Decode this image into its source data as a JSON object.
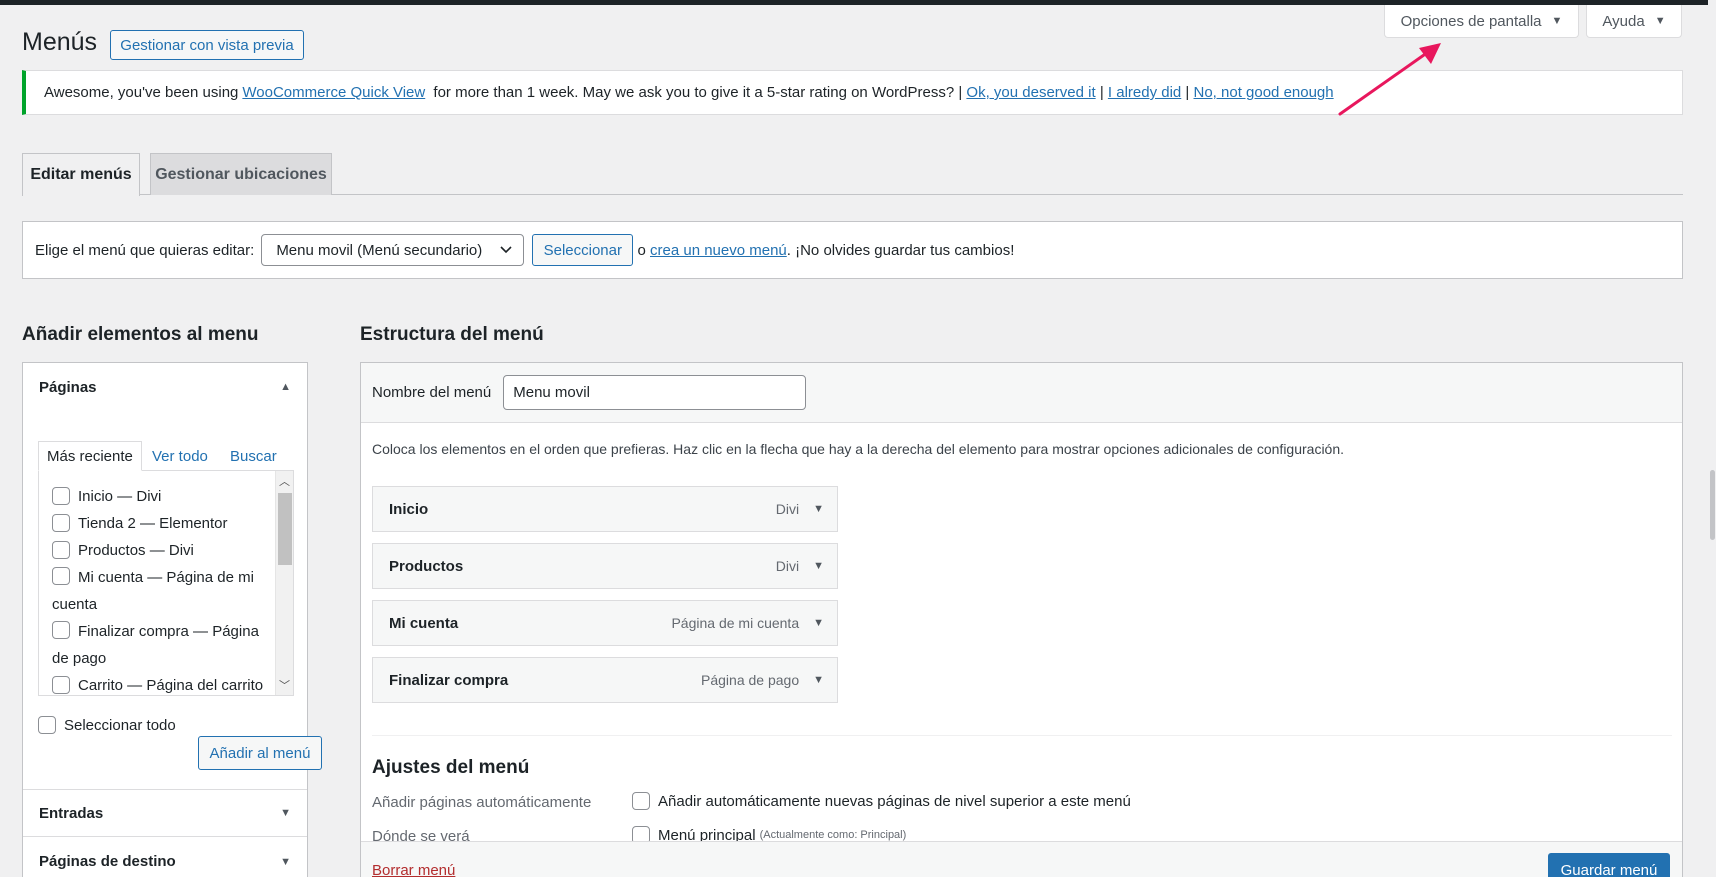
{
  "screen_meta": {
    "screen_options": "Opciones de pantalla",
    "help": "Ayuda"
  },
  "header": {
    "title": "Menús",
    "manage_preview": "Gestionar con vista previa"
  },
  "notice": {
    "text_1": "Awesome, you've been using ",
    "link_plugin": "WooCommerce Quick View",
    "text_2": " for more than 1 week. May we ask you to give it a 5-star rating on WordPress? | ",
    "link_ok": "Ok, you deserved it",
    "sep_1": " | ",
    "link_already": "I alredy did",
    "sep_2": " | ",
    "link_no": "No, not good enough"
  },
  "tabs": {
    "edit": "Editar menús",
    "locations": "Gestionar ubicaciones"
  },
  "select_bar": {
    "label": "Elige el menú que quieras editar:",
    "selected": "Menu movil (Menú secundario)",
    "button": "Seleccionar",
    "text_or": " o ",
    "link_create": "crea un nuevo menú",
    "text_end": ". ¡No olvides guardar tus cambios!"
  },
  "add_items": {
    "heading": "Añadir elementos al menu",
    "pages_title": "Páginas",
    "subtabs": {
      "recent": "Más reciente",
      "all": "Ver todo",
      "search": "Buscar"
    },
    "pages": [
      {
        "name": "Inicio — ",
        "tpl": "Divi"
      },
      {
        "name": "Tienda 2 — ",
        "tpl": "Elementor"
      },
      {
        "name": "Productos — ",
        "tpl": "Divi"
      },
      {
        "name": "Mi cuenta — ",
        "tpl": "Página de mi cuenta"
      },
      {
        "name": "Finalizar compra — ",
        "tpl": "Página de pago"
      },
      {
        "name": "Carrito — ",
        "tpl": "Página del carrito"
      }
    ],
    "select_all": "Seleccionar todo",
    "add_button": "Añadir al menú",
    "posts_title": "Entradas",
    "landing_title": "Páginas de destino"
  },
  "structure": {
    "heading": "Estructura del menú",
    "name_label": "Nombre del menú",
    "name_value": "Menu movil",
    "instructions": "Coloca los elementos en el orden que prefieras. Haz clic en la flecha que hay a la derecha del elemento para mostrar opciones adicionales de configuración.",
    "items": [
      {
        "title": "Inicio",
        "type": "Divi"
      },
      {
        "title": "Productos",
        "type": "Divi"
      },
      {
        "title": "Mi cuenta",
        "type": "Página de mi cuenta"
      },
      {
        "title": "Finalizar compra",
        "type": "Página de pago"
      }
    ],
    "settings_heading": "Ajustes del menú",
    "auto_add_label": "Añadir páginas automáticamente",
    "auto_add_option": "Añadir automáticamente nuevas páginas de nivel superior a este menú",
    "location_label": "Dónde se verá",
    "location_option": "Menú principal",
    "location_note": "(Actualmente como: Principal)",
    "delete_link": "Borrar menú",
    "save_button": "Guardar menú"
  },
  "colors": {
    "accent": "#2271b1",
    "notice_border": "#00a32a",
    "annotation_arrow": "#e8175d",
    "delete": "#b32d2e"
  },
  "icons": [
    "caret-down-icon",
    "caret-up-icon",
    "chevron-down-icon",
    "annotation-arrow-icon"
  ]
}
